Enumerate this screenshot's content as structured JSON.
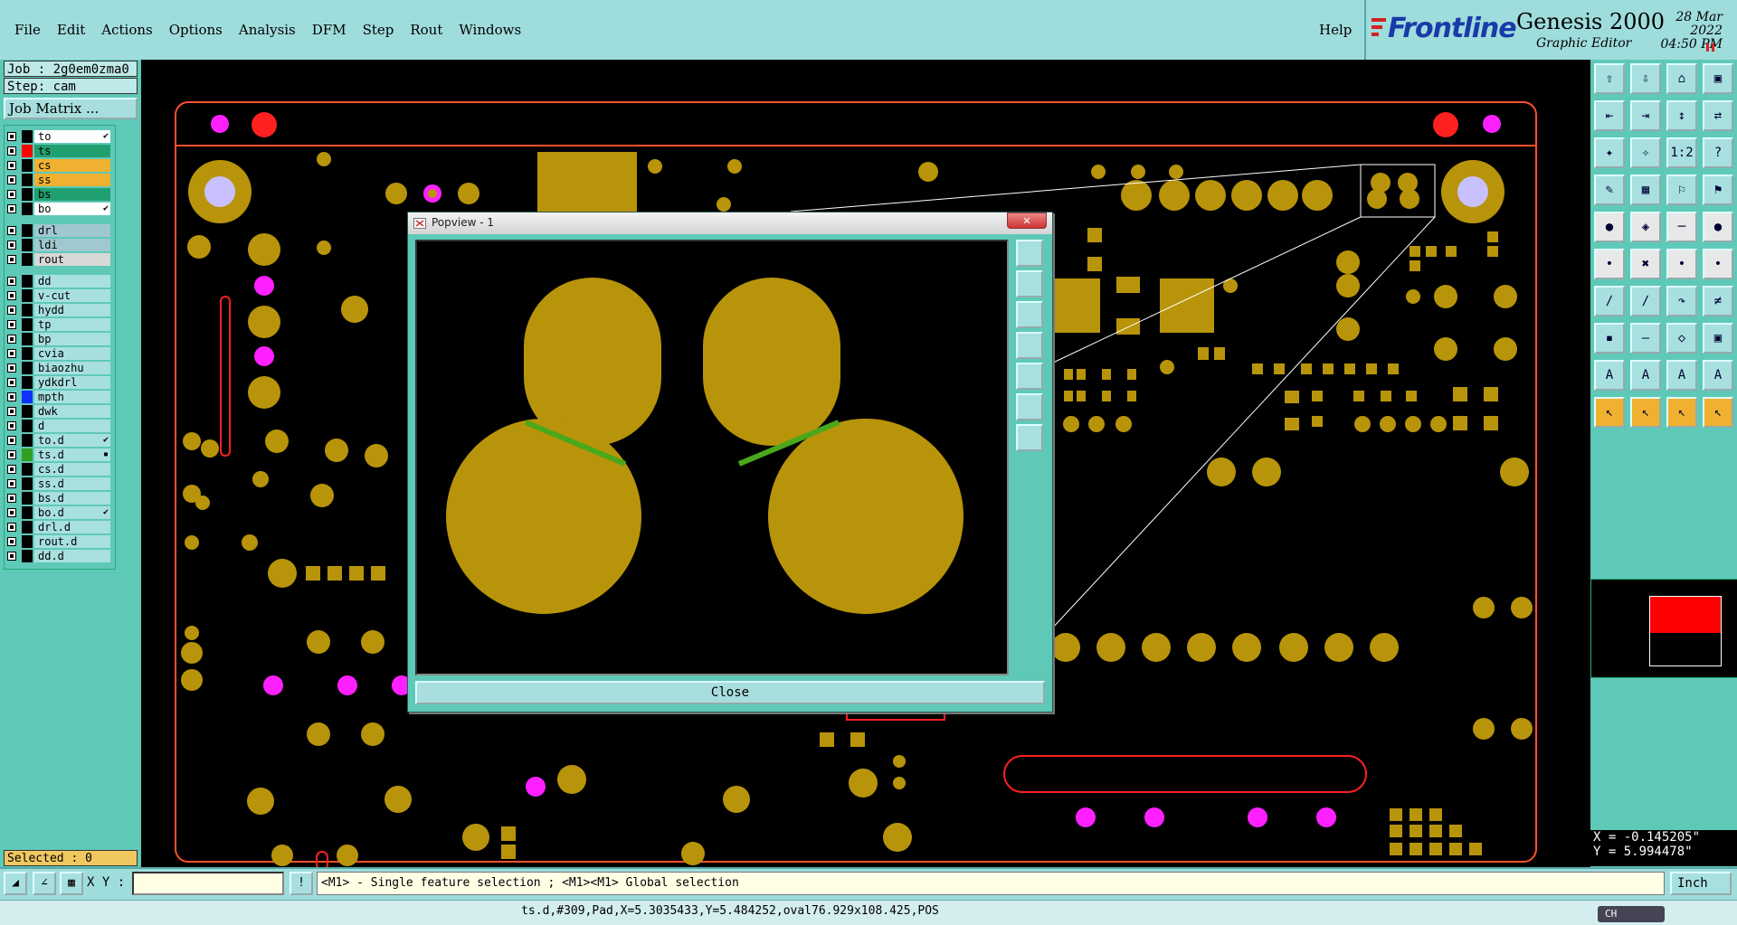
{
  "menu": {
    "items": [
      "File",
      "Edit",
      "Actions",
      "Options",
      "Analysis",
      "DFM",
      "Step",
      "Rout",
      "Windows"
    ],
    "help": "Help"
  },
  "brand": {
    "logo_text": "Frontline",
    "product": "Genesis 2000",
    "subtitle": "Graphic Editor",
    "date": "28 Mar 2022",
    "time": "04:50 PM",
    "colors": {
      "logo_blue": "#1a3aa8",
      "logo_red": "#d22222"
    }
  },
  "left_panel": {
    "job": "Job : 2g0em0zma0",
    "step": "Step: cam",
    "job_matrix": "Job Matrix ...",
    "selected": "Selected : 0",
    "layers": [
      {
        "name": "to",
        "color": "#000000",
        "bg": "#ffffff",
        "flag": "✔"
      },
      {
        "name": "ts",
        "color": "#ff0000",
        "bg": "#20a070",
        "flag": ""
      },
      {
        "name": "cs",
        "color": "#000000",
        "bg": "#f0b030",
        "flag": ""
      },
      {
        "name": "ss",
        "color": "#000000",
        "bg": "#f0b030",
        "flag": ""
      },
      {
        "name": "bs",
        "color": "#000000",
        "bg": "#20a070",
        "flag": ""
      },
      {
        "name": "bo",
        "color": "#000000",
        "bg": "#ffffff",
        "flag": "✔"
      },
      {
        "name": "drl",
        "color": "#000000",
        "bg": "#a0c8d0",
        "flag": ""
      },
      {
        "name": "ldi",
        "color": "#000000",
        "bg": "#a0c8d0",
        "flag": ""
      },
      {
        "name": "rout",
        "color": "#000000",
        "bg": "#d8d8d8",
        "flag": ""
      },
      {
        "name": "dd",
        "color": "#000000",
        "bg": "#a8e0e0",
        "flag": ""
      },
      {
        "name": "v-cut",
        "color": "#000000",
        "bg": "#a8e0e0",
        "flag": ""
      },
      {
        "name": "hydd",
        "color": "#000000",
        "bg": "#a8e0e0",
        "flag": ""
      },
      {
        "name": "tp",
        "color": "#000000",
        "bg": "#a8e0e0",
        "flag": ""
      },
      {
        "name": "bp",
        "color": "#000000",
        "bg": "#a8e0e0",
        "flag": ""
      },
      {
        "name": "cvia",
        "color": "#000000",
        "bg": "#a8e0e0",
        "flag": ""
      },
      {
        "name": "biaozhu",
        "color": "#000000",
        "bg": "#a8e0e0",
        "flag": ""
      },
      {
        "name": "ydkdrl",
        "color": "#000000",
        "bg": "#a8e0e0",
        "flag": ""
      },
      {
        "name": "mpth",
        "color": "#1030ff",
        "bg": "#a8e0e0",
        "flag": ""
      },
      {
        "name": "dwk",
        "color": "#000000",
        "bg": "#a8e0e0",
        "flag": ""
      },
      {
        "name": "d",
        "color": "#000000",
        "bg": "#a8e0e0",
        "flag": ""
      },
      {
        "name": "to.d",
        "color": "#000000",
        "bg": "#a8e0e0",
        "flag": "✔"
      },
      {
        "name": "ts.d",
        "color": "#30a020",
        "bg": "#a8e0e0",
        "flag": "▪"
      },
      {
        "name": "cs.d",
        "color": "#000000",
        "bg": "#a8e0e0",
        "flag": ""
      },
      {
        "name": "ss.d",
        "color": "#000000",
        "bg": "#a8e0e0",
        "flag": ""
      },
      {
        "name": "bs.d",
        "color": "#000000",
        "bg": "#a8e0e0",
        "flag": ""
      },
      {
        "name": "bo.d",
        "color": "#000000",
        "bg": "#a8e0e0",
        "flag": "✔"
      },
      {
        "name": "drl.d",
        "color": "#000000",
        "bg": "#a8e0e0",
        "flag": ""
      },
      {
        "name": "rout.d",
        "color": "#000000",
        "bg": "#a8e0e0",
        "flag": ""
      },
      {
        "name": "dd.d",
        "color": "#000000",
        "bg": "#a8e0e0",
        "flag": ""
      }
    ]
  },
  "popview": {
    "title": "Popview - 1",
    "close_x": "✕",
    "close_button": "Close",
    "tools": [
      "zoom-fit-icon",
      "zoom-home-icon",
      "pan-up-icon",
      "pan-left-icon",
      "pan-right-icon",
      "zoom-in-icon",
      "zoom-out-icon"
    ]
  },
  "right_toolbar": {
    "buttons": [
      "⇧",
      "⇩",
      "⌂",
      "▣",
      "⇤",
      "⇥",
      "↕",
      "⇄",
      "✦",
      "✧",
      "1:2",
      "?",
      "✎",
      "▦",
      "⚐",
      "⚑",
      "●",
      "◈",
      "─",
      "●",
      "•",
      "✖",
      "•",
      "•",
      "∕",
      "∕",
      "↷",
      "≠",
      "▪",
      "—",
      "◇",
      "▣",
      "A",
      "A",
      "A",
      "A",
      "↖",
      "↖",
      "↖",
      "↖"
    ],
    "coord_x": "X = -0.145205\"",
    "coord_y": "Y = 5.994478\""
  },
  "bottom": {
    "xy_label": "X Y :",
    "xy_value": "",
    "exclaim": "!",
    "prompt": "<M1> - Single feature selection ; <M1><M1> Global selection",
    "units": "Inch",
    "status": "ts.d,#309,Pad,X=5.3035433,Y=5.484252,oval76.929x108.425,POS",
    "ime": "CH"
  },
  "colors": {
    "pad_gold": "#b8940a",
    "outline_red": "#ff2020",
    "magenta": "#ff20ff",
    "lavender": "#c8c0ff",
    "highlight_green": "#4aa81a"
  }
}
